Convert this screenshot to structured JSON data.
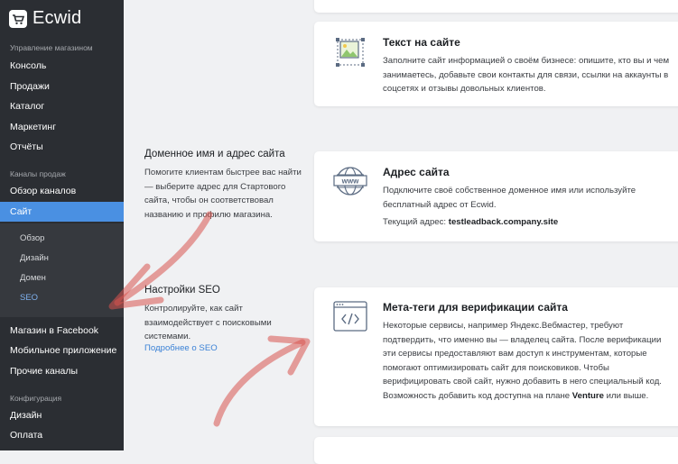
{
  "sidebar": {
    "logo": "Ecwid",
    "section_store": "Управление магазином",
    "store_items": [
      "Консоль",
      "Продажи",
      "Каталог",
      "Маркетинг",
      "Отчёты"
    ],
    "section_channels": "Каналы продаж",
    "channels_overview": "Обзор каналов",
    "site_active": "Сайт",
    "site_subitems": [
      "Обзор",
      "Дизайн",
      "Домен",
      "SEO"
    ],
    "other_channels": [
      "Магазин в Facebook",
      "Мобильное приложение",
      "Прочие каналы"
    ],
    "section_config": "Конфигурация",
    "config_items": [
      "Дизайн",
      "Оплата"
    ]
  },
  "main": {
    "text_card": {
      "title": "Текст на сайте",
      "text": "Заполните сайт информацией о своём бизнесе: опишите, кто вы и чем занимаетесь, добавьте свои контакты для связи, ссылки на аккаунты в соцсетях и отзывы довольных клиентов."
    },
    "domain_section": {
      "title": "Доменное имя и адрес сайта",
      "text": "Помогите клиентам быстрее вас найти — выберите адрес для Стартового сайта, чтобы он соответствовал названию и профилю магазина."
    },
    "address_card": {
      "title": "Адрес сайта",
      "text": "Подключите своё собственное доменное имя или используйте бесплатный адрес от Ecwid.",
      "current_label": "Текущий адрес: ",
      "current_value": "testleadback.company.site",
      "icon_text": "www"
    },
    "seo_section": {
      "title": "Настройки SEO",
      "text": "Контролируйте, как сайт взаимодействует с поисковыми системами.",
      "link": "Подробнее о SEO"
    },
    "meta_card": {
      "title": "Мета-теги для верификации сайта",
      "text_part1": "Некоторые сервисы, например Яндекс.Вебмастер, требуют подтвердить, что именно вы — владелец сайта. После верификации эти сервисы предоставляют вам доступ к инструментам, которые помогают оптимизировать сайт для поисковиков. Чтобы верифицировать свой сайт, нужно добавить в него специальный код. Возможность добавить код доступна на плане ",
      "plan": "Venture",
      "text_part2": " или выше."
    }
  },
  "colors": {
    "sidebar_bg": "#2b2e33",
    "active_bg": "#4a90e2",
    "link": "#3b82d6",
    "annotation": "#d9534f"
  }
}
